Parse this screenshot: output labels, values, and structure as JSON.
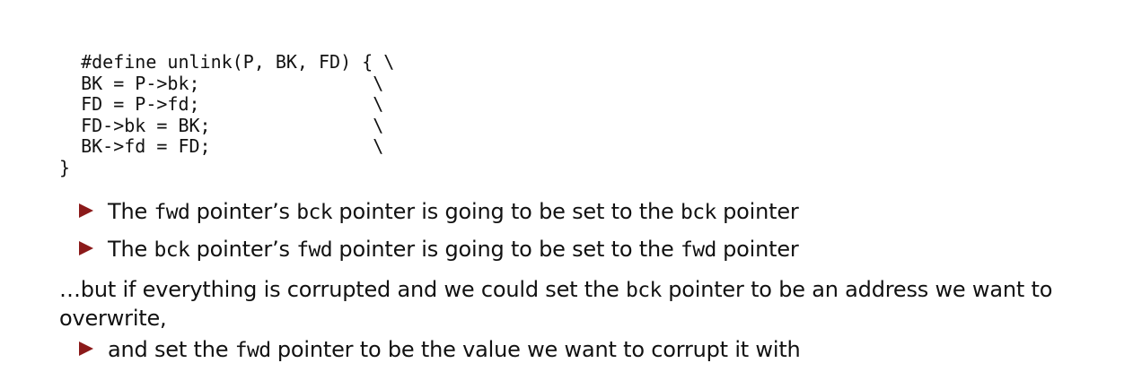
{
  "code": {
    "lines": [
      "  #define unlink(P, BK, FD) { \\",
      "  BK = P->bk;                \\",
      "  FD = P->fd;                \\",
      "  FD->bk = BK;               \\",
      "  BK->fd = FD;               \\",
      "}"
    ]
  },
  "bullets": [
    {
      "p1": "The ",
      "c1": "fwd",
      "p2": " pointer’s ",
      "c2": "bck",
      "p3": " pointer is going to be set to the ",
      "c3": "bck",
      "p4": " pointer"
    },
    {
      "p1": "The ",
      "c1": "bck",
      "p2": " pointer’s ",
      "c2": "fwd",
      "p3": " pointer is going to be set to the ",
      "c3": "fwd",
      "p4": " pointer"
    }
  ],
  "paragraph": {
    "p1": "…but if everything is corrupted and we could set the ",
    "c1": "bck",
    "p2": " pointer to be an address we want to overwrite,"
  },
  "bullet3": {
    "p1": "and set the ",
    "c1": "fwd",
    "p2": " pointer to be the value we want to corrupt it with"
  },
  "colors": {
    "bullet": "#8b1a1a",
    "text": "#111111"
  }
}
